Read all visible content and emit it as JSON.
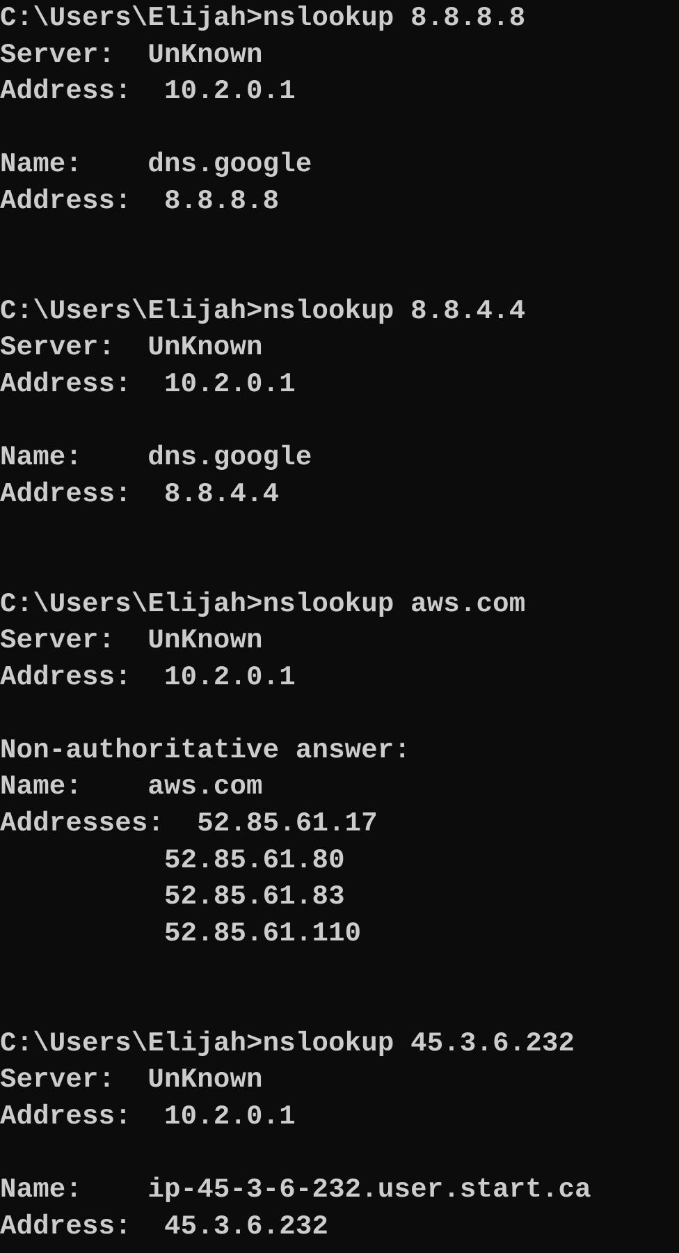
{
  "terminal": {
    "blocks": [
      {
        "prompt": "C:\\Users\\Elijah>nslookup 8.8.8.8",
        "server": "Server:  UnKnown",
        "server_address": "Address:  10.2.0.1",
        "lines": [
          "Name:    dns.google",
          "Address:  8.8.8.8"
        ]
      },
      {
        "prompt": "C:\\Users\\Elijah>nslookup 8.8.4.4",
        "server": "Server:  UnKnown",
        "server_address": "Address:  10.2.0.1",
        "lines": [
          "Name:    dns.google",
          "Address:  8.8.4.4"
        ]
      },
      {
        "prompt": "C:\\Users\\Elijah>nslookup aws.com",
        "server": "Server:  UnKnown",
        "server_address": "Address:  10.2.0.1",
        "lines": [
          "Non-authoritative answer:",
          "Name:    aws.com",
          "Addresses:  52.85.61.17",
          "          52.85.61.80",
          "          52.85.61.83",
          "          52.85.61.110"
        ]
      },
      {
        "prompt": "C:\\Users\\Elijah>nslookup 45.3.6.232",
        "server": "Server:  UnKnown",
        "server_address": "Address:  10.2.0.1",
        "lines": [
          "Name:    ip-45-3-6-232.user.start.ca",
          "Address:  45.3.6.232"
        ]
      }
    ]
  }
}
